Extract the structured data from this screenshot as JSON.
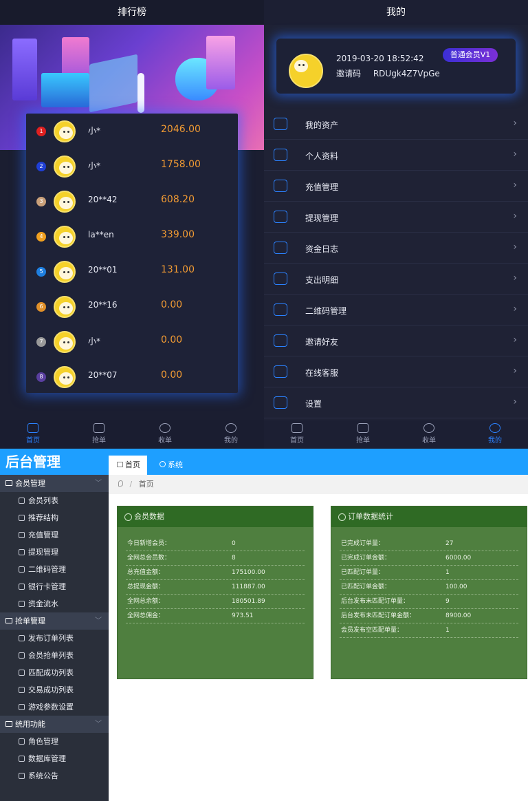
{
  "left": {
    "title": "排行榜",
    "ranking": [
      {
        "rank": "1",
        "name": "小*",
        "value": "2046.00",
        "color": "#e02020"
      },
      {
        "rank": "2",
        "name": "小*",
        "value": "1758.00",
        "color": "#1f3fd6"
      },
      {
        "rank": "3",
        "name": "20**42",
        "value": "608.20",
        "color": "#c9a07a"
      },
      {
        "rank": "4",
        "name": "la**en",
        "value": "339.00",
        "color": "#f0a020"
      },
      {
        "rank": "5",
        "name": "20**01",
        "value": "131.00",
        "color": "#1e7fe0"
      },
      {
        "rank": "6",
        "name": "20**16",
        "value": "0.00",
        "color": "#e0902a"
      },
      {
        "rank": "7",
        "name": "小*",
        "value": "0.00",
        "color": "#9a9a9a"
      },
      {
        "rank": "8",
        "name": "20**07",
        "value": "0.00",
        "color": "#5a3fa0"
      }
    ],
    "tabs": [
      "首页",
      "抢单",
      "收单",
      "我的"
    ]
  },
  "right": {
    "title": "我的",
    "profile": {
      "datetime": "2019-03-20 18:52:42",
      "invite_label": "邀请码",
      "invite_code": "RDUgk4Z7VpGe",
      "member_level": "普通会员V1"
    },
    "menu": [
      {
        "label": "我的资产",
        "icon": "coins-icon"
      },
      {
        "label": "个人资料",
        "icon": "document-icon"
      },
      {
        "label": "充值管理",
        "icon": "yen-shield-icon"
      },
      {
        "label": "提现管理",
        "icon": "cash-icon"
      },
      {
        "label": "资金日志",
        "icon": "cash-log-icon"
      },
      {
        "label": "支出明细",
        "icon": "expense-icon"
      },
      {
        "label": "二维码管理",
        "icon": "qrcode-icon"
      },
      {
        "label": "邀请好友",
        "icon": "paper-plane-icon"
      },
      {
        "label": "在线客服",
        "icon": "chat-icon"
      },
      {
        "label": "设置",
        "icon": "gear-icon"
      }
    ],
    "tabs": [
      "首页",
      "抢单",
      "收单",
      "我的"
    ]
  },
  "admin": {
    "logo": "后台管理",
    "groups": [
      {
        "label": "会员管理",
        "items": [
          "会员列表",
          "推荐结构",
          "充值管理",
          "提现管理",
          "二维码管理",
          "银行卡管理",
          "资金流水"
        ]
      },
      {
        "label": "抢单管理",
        "items": [
          "发布订单列表",
          "会员抢单列表",
          "匹配成功列表",
          "交易成功列表",
          "游戏参数设置"
        ]
      },
      {
        "label": "统用功能",
        "items": [
          "角色管理",
          "数据库管理",
          "系统公告"
        ]
      }
    ],
    "top_tabs": [
      "首页",
      "系统"
    ],
    "breadcrumb": "首页",
    "member_card": {
      "title": "会员数据",
      "rows": [
        {
          "k": "今日新增会员：",
          "v": "0"
        },
        {
          "k": "全网总会员数：",
          "v": "8"
        },
        {
          "k": "总充值金额：",
          "v": "175100.00"
        },
        {
          "k": "总提现金额：",
          "v": "111887.00"
        },
        {
          "k": "全网总余额：",
          "v": "180501.89"
        },
        {
          "k": "全网总佣金：",
          "v": "973.51"
        }
      ]
    },
    "order_card": {
      "title": "订单数据统计",
      "rows": [
        {
          "k": "已完成订单量：",
          "v": "27"
        },
        {
          "k": "已完成订单金额：",
          "v": "6000.00"
        },
        {
          "k": "已匹配订单量：",
          "v": "1"
        },
        {
          "k": "已匹配订单金额：",
          "v": "100.00"
        },
        {
          "k": "后台发布未匹配订单量：",
          "v": "9"
        },
        {
          "k": "后台发布未匹配订单金额：",
          "v": "8900.00"
        },
        {
          "k": "会员发布空匹配单量：",
          "v": "1"
        }
      ]
    }
  }
}
